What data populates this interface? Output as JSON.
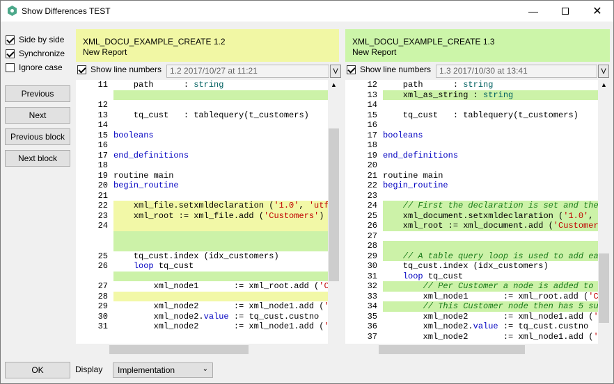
{
  "window": {
    "title": "Show Differences TEST"
  },
  "options": {
    "side_by_side": "Side by side",
    "synchronize": "Synchronize",
    "ignore_case": "Ignore case"
  },
  "buttons": {
    "previous": "Previous",
    "next": "Next",
    "previous_block": "Previous block",
    "next_block": "Next block",
    "ok": "OK"
  },
  "footer": {
    "display_label": "Display",
    "display_value": "Implementation"
  },
  "left": {
    "name": "XML_DOCU_EXAMPLE_CREATE 1.2",
    "sub": "New Report",
    "show_line_numbers": "Show line numbers",
    "version": "1.2   2017/10/27 at 11:21",
    "lines": [
      {
        "n": "11",
        "t": "    path      : string"
      },
      {
        "n": "",
        "t": ""
      },
      {
        "n": "12",
        "t": ""
      },
      {
        "n": "13",
        "t": "    tq_cust   : tablequery(t_customers)"
      },
      {
        "n": "14",
        "t": ""
      },
      {
        "n": "15",
        "t": "booleans"
      },
      {
        "n": "16",
        "t": ""
      },
      {
        "n": "17",
        "t": "end_definitions"
      },
      {
        "n": "18",
        "t": ""
      },
      {
        "n": "19",
        "t": "routine main"
      },
      {
        "n": "20",
        "t": "begin_routine"
      },
      {
        "n": "21",
        "t": ""
      },
      {
        "n": "22",
        "t": "    xml_file.setxmldeclaration ('1.0', 'utf"
      },
      {
        "n": "23",
        "t": "    xml_root := xml_file.add ('Customers')"
      },
      {
        "n": "24",
        "t": ""
      },
      {
        "n": "",
        "t": ""
      },
      {
        "n": "",
        "t": ""
      },
      {
        "n": "25",
        "t": "    tq_cust.index (idx_customers)"
      },
      {
        "n": "26",
        "t": "    loop tq_cust"
      },
      {
        "n": "",
        "t": ""
      },
      {
        "n": "27",
        "t": "        xml_node1       := xml_root.add ('C"
      },
      {
        "n": "28",
        "t": ""
      },
      {
        "n": "29",
        "t": "        xml_node2       := xml_node1.add ('"
      },
      {
        "n": "30",
        "t": "        xml_node2.value := tq_cust.custno"
      },
      {
        "n": "31",
        "t": "        xml_node2       := xml_node1.add ('"
      }
    ]
  },
  "right": {
    "name": "XML_DOCU_EXAMPLE_CREATE 1.3",
    "sub": "New Report",
    "show_line_numbers": "Show line numbers",
    "version": "1.3   2017/10/30 at 13:41",
    "lines": [
      {
        "n": "12",
        "t": "    path      : string"
      },
      {
        "n": "13",
        "t": "    xml_as_string : string"
      },
      {
        "n": "14",
        "t": ""
      },
      {
        "n": "15",
        "t": "    tq_cust   : tablequery(t_customers)"
      },
      {
        "n": "16",
        "t": ""
      },
      {
        "n": "17",
        "t": "booleans"
      },
      {
        "n": "18",
        "t": ""
      },
      {
        "n": "19",
        "t": "end_definitions"
      },
      {
        "n": "20",
        "t": ""
      },
      {
        "n": "21",
        "t": "routine main"
      },
      {
        "n": "22",
        "t": "begin_routine"
      },
      {
        "n": "23",
        "t": ""
      },
      {
        "n": "24",
        "t": "    // First the declaration is set and the"
      },
      {
        "n": "25",
        "t": "    xml_document.setxmldeclaration ('1.0',"
      },
      {
        "n": "26",
        "t": "    xml_root := xml_document.add ('Customer"
      },
      {
        "n": "27",
        "t": ""
      },
      {
        "n": "28",
        "t": ""
      },
      {
        "n": "29",
        "t": "    // A table query loop is used to add ea"
      },
      {
        "n": "30",
        "t": "    tq_cust.index (idx_customers)"
      },
      {
        "n": "31",
        "t": "    loop tq_cust"
      },
      {
        "n": "32",
        "t": "        // Per Customer a node is added to"
      },
      {
        "n": "33",
        "t": "        xml_node1       := xml_root.add ('C"
      },
      {
        "n": "34",
        "t": "        // This Customer node then has 5 su"
      },
      {
        "n": "35",
        "t": "        xml_node2       := xml_node1.add ('"
      },
      {
        "n": "36",
        "t": "        xml_node2.value := tq_cust.custno"
      },
      {
        "n": "37",
        "t": "        xml_node2       := xml_node1.add ('"
      }
    ]
  },
  "colors": {
    "yellow": "#f2f8a7",
    "green": "#ccf2a8",
    "header_left": "#f1f7a4",
    "header_right": "#ccf5a9"
  }
}
